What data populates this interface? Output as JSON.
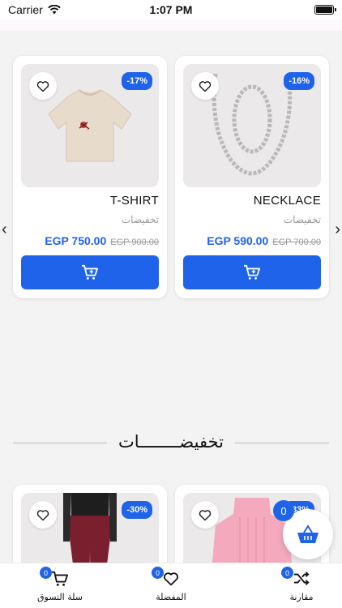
{
  "status_bar": {
    "carrier": "Carrier",
    "time": "1:07 PM"
  },
  "featured_products": [
    {
      "name": "T-SHIRT",
      "label": "تخفيضات",
      "discount": "-17%",
      "price": "EGP 750.00",
      "old_price": "EGP 900.00",
      "image": "tshirt",
      "favorite_icon": "heart-outline-icon",
      "cart_icon": "cart-add-icon"
    },
    {
      "name": "NECKLACE",
      "label": "تخفيضات",
      "discount": "-16%",
      "price": "EGP 590.00",
      "old_price": "EGP 700.00",
      "image": "necklace",
      "favorite_icon": "heart-outline-icon",
      "cart_icon": "cart-add-icon"
    }
  ],
  "carousel": {
    "prev_icon": "chevron-left-icon",
    "next_icon": "chevron-right-icon",
    "prev_glyph": "‹",
    "next_glyph": "›"
  },
  "sale_section": {
    "title": "تخفيضــــــــات"
  },
  "sale_products": [
    {
      "discount": "-30%",
      "image": "leggings",
      "favorite_icon": "heart-outline-icon"
    },
    {
      "discount": "-33%",
      "image": "pink-sweater",
      "favorite_icon": "heart-outline-icon"
    }
  ],
  "basket": {
    "count": "0",
    "icon": "basket-icon"
  },
  "bottom_nav": [
    {
      "label": "سلة التسوق",
      "count": "0",
      "icon": "cart-icon"
    },
    {
      "label": "المفضلة",
      "count": "0",
      "icon": "heart-icon"
    },
    {
      "label": "مقارنة",
      "count": "0",
      "icon": "shuffle-icon"
    }
  ],
  "colors": {
    "accent": "#1e63e9",
    "background": "#f4f3f3",
    "muted": "#9a9a9a"
  }
}
